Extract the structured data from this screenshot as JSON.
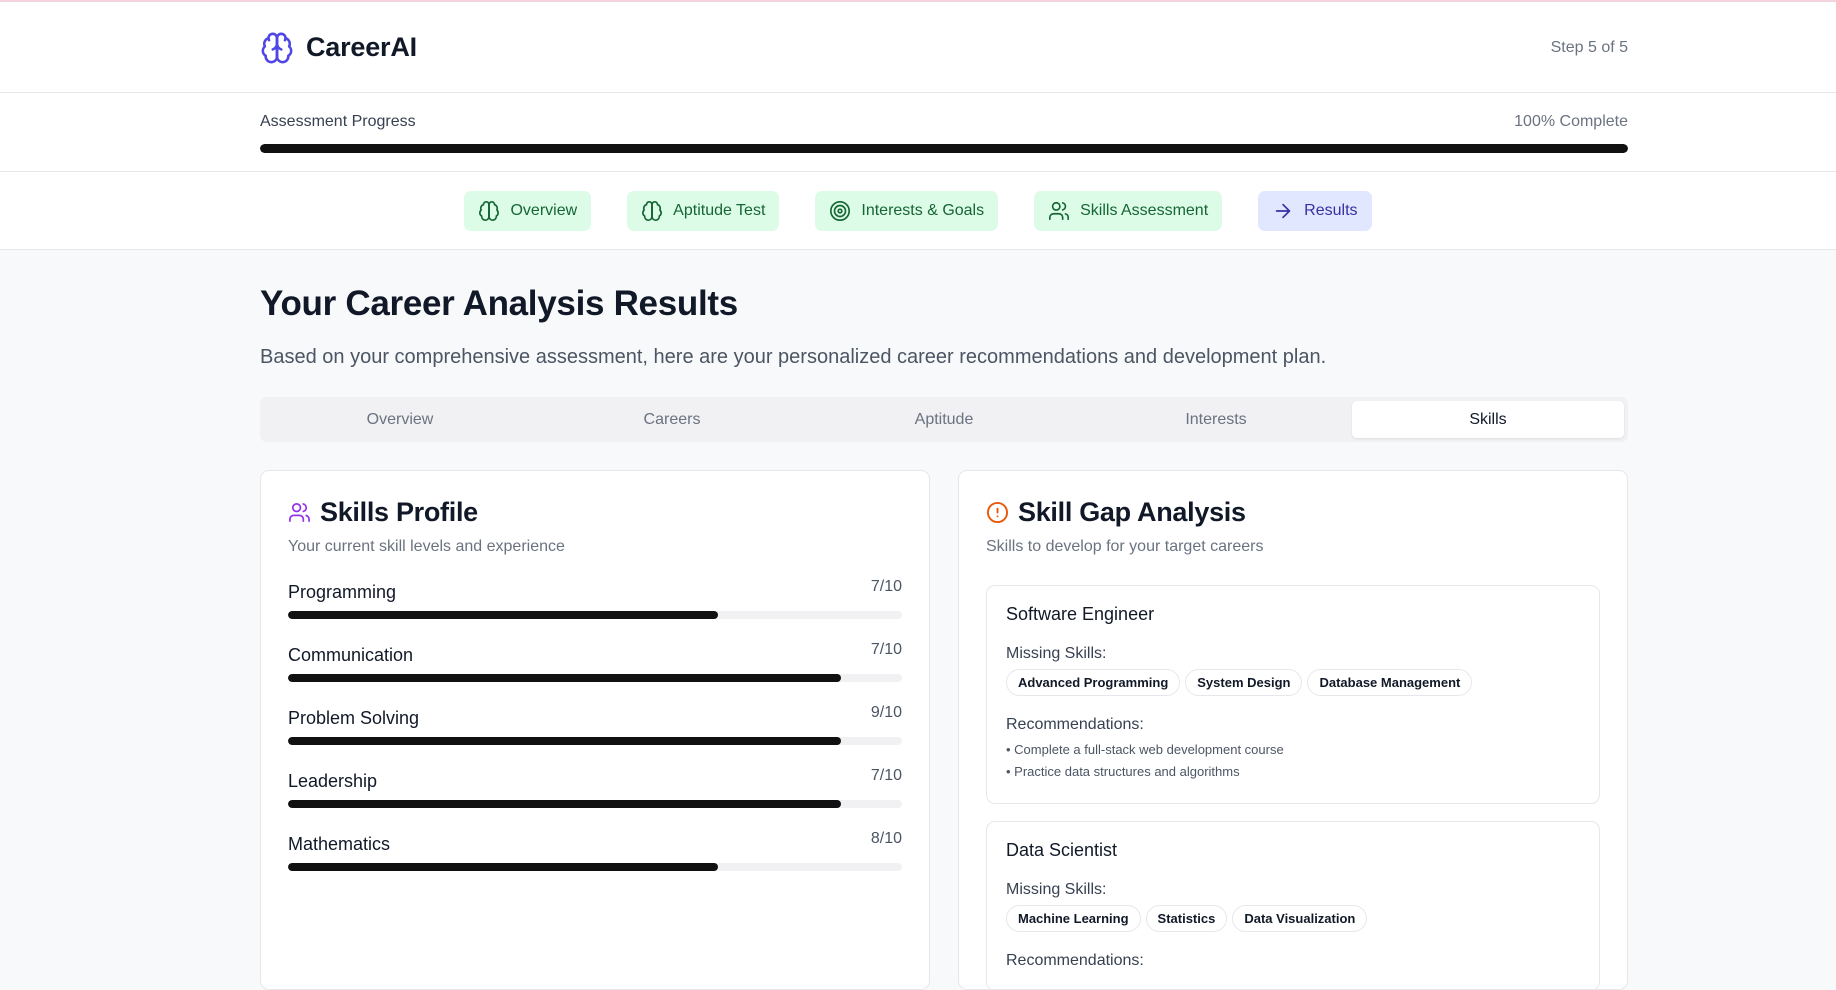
{
  "app": {
    "brand": "CareerAI",
    "step_text": "Step 5 of 5"
  },
  "progress": {
    "label": "Assessment Progress",
    "percent_text": "100% Complete",
    "value": 1.0
  },
  "steps": [
    {
      "label": "Overview",
      "icon": "brain-icon"
    },
    {
      "label": "Aptitude Test",
      "icon": "brain-icon"
    },
    {
      "label": "Interests & Goals",
      "icon": "target-icon"
    },
    {
      "label": "Skills Assessment",
      "icon": "users-icon"
    },
    {
      "label": "Results",
      "icon": "arrow-right-icon"
    }
  ],
  "page": {
    "title": "Your Career Analysis Results",
    "subtitle": "Based on your comprehensive assessment, here are your personalized career recommendations and development plan."
  },
  "tabs": [
    "Overview",
    "Careers",
    "Aptitude",
    "Interests",
    "Skills"
  ],
  "active_tab": "Skills",
  "skills_profile": {
    "title": "Skills Profile",
    "subtitle": "Your current skill levels and experience",
    "skills": [
      {
        "name": "Programming",
        "value_text": "7/10",
        "fill": 0.7
      },
      {
        "name": "Communication",
        "value_text": "7/10",
        "fill": 0.9
      },
      {
        "name": "Problem Solving",
        "value_text": "9/10",
        "fill": 0.9
      },
      {
        "name": "Leadership",
        "value_text": "7/10",
        "fill": 0.9
      },
      {
        "name": "Mathematics",
        "value_text": "8/10",
        "fill": 0.7
      }
    ]
  },
  "skill_gap": {
    "title": "Skill Gap Analysis",
    "subtitle": "Skills to develop for your target careers",
    "missing_label": "Missing Skills:",
    "recommendations_label": "Recommendations:",
    "careers": [
      {
        "title": "Software Engineer",
        "missing": [
          "Advanced Programming",
          "System Design",
          "Database Management"
        ],
        "recommendations": [
          "• Complete a full-stack web development course",
          "• Practice data structures and algorithms"
        ]
      },
      {
        "title": "Data Scientist",
        "missing": [
          "Machine Learning",
          "Statistics",
          "Data Visualization"
        ],
        "recommendations": []
      }
    ]
  },
  "colors": {
    "accent": "#4f46e5",
    "step_done_bg": "#dcfce7",
    "step_done_text": "#166534",
    "step_active_bg": "#e0e7ff",
    "skills_icon": "#9333ea",
    "gap_icon": "#ea580c",
    "bar": "#111111"
  }
}
